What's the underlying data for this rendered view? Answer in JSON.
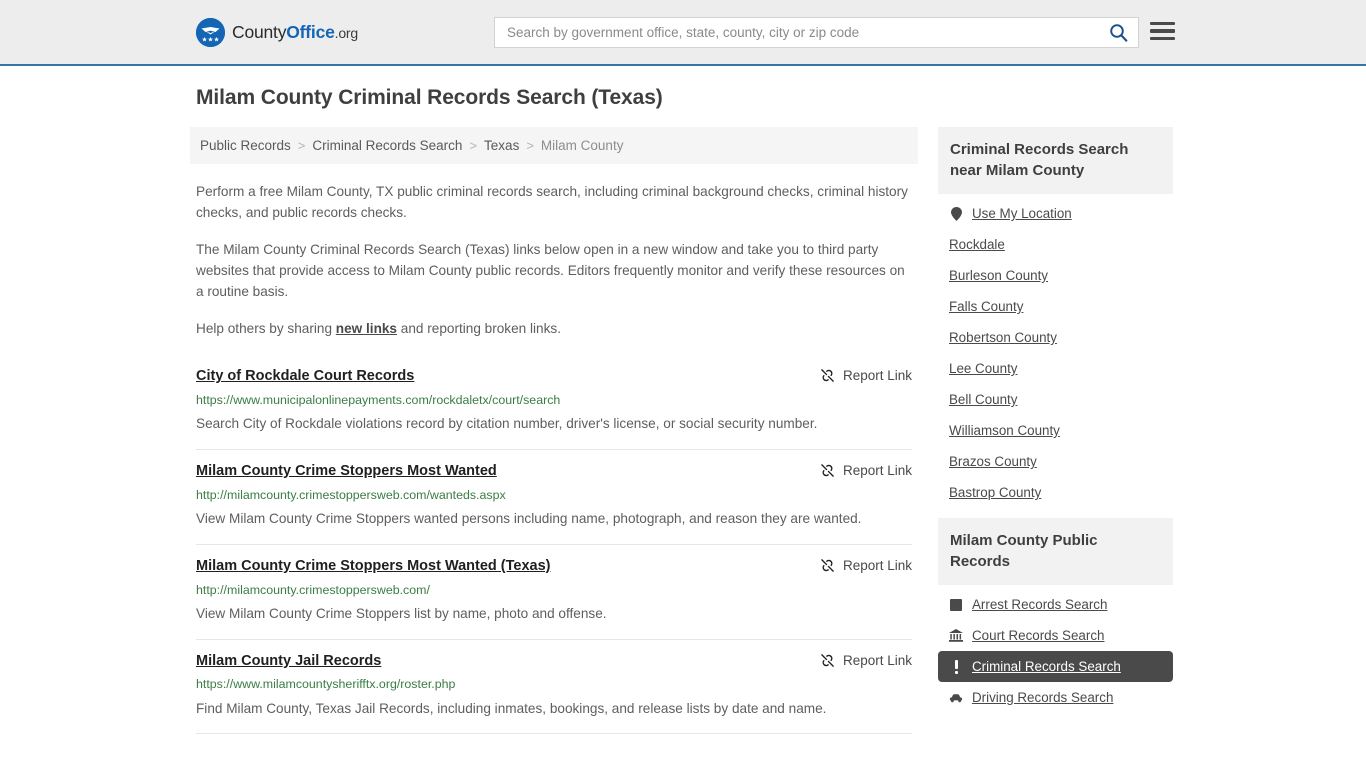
{
  "header": {
    "logo": {
      "icon": "eagle-shield-icon",
      "text_part1": "County",
      "text_part2": "Office",
      "text_part3": ".org",
      "brand_color": "#1565b5"
    },
    "search": {
      "placeholder": "Search by government office, state, county, city or zip code",
      "value": "",
      "search_icon": "magnifier-icon",
      "icon_color": "#1a4f87"
    },
    "menu_icon": "hamburger-menu-icon",
    "background": "#ededed",
    "accent_border": "#3a73a8"
  },
  "main": {
    "page_title": "Milam County Criminal Records Search (Texas)",
    "breadcrumb": {
      "separator": ">",
      "items": [
        {
          "label": "Public Records",
          "current": false
        },
        {
          "label": "Criminal Records Search",
          "current": false
        },
        {
          "label": "Texas",
          "current": false
        },
        {
          "label": "Milam County",
          "current": true
        }
      ]
    },
    "intro": {
      "paragraph1": "Perform a free Milam County, TX public criminal records search, including criminal background checks, criminal history checks, and public records checks.",
      "paragraph2": "The Milam County Criminal Records Search (Texas) links below open in a new window and take you to third party websites that provide access to Milam County public records. Editors frequently monitor and verify these resources on a routine basis.",
      "paragraph3_before": "Help others by sharing ",
      "paragraph3_link": "new links",
      "paragraph3_after": " and reporting broken links."
    },
    "report_link_label": "Report Link",
    "report_link_icon": "broken-link-icon",
    "results": [
      {
        "title": "City of Rockdale Court Records",
        "url": "https://www.municipalonlinepayments.com/rockdaletx/court/search",
        "description": "Search City of Rockdale violations record by citation number, driver's license, or social security number."
      },
      {
        "title": "Milam County Crime Stoppers Most Wanted",
        "url": "http://milamcounty.crimestoppersweb.com/wanteds.aspx",
        "description": "View Milam County Crime Stoppers wanted persons including name, photograph, and reason they are wanted."
      },
      {
        "title": "Milam County Crime Stoppers Most Wanted (Texas)",
        "url": "http://milamcounty.crimestoppersweb.com/",
        "description": "View Milam County Crime Stoppers list by name, photo and offense."
      },
      {
        "title": "Milam County Jail Records",
        "url": "https://www.milamcountysherifftx.org/roster.php",
        "description": "Find Milam County, Texas Jail Records, including inmates, bookings, and release lists by date and name."
      }
    ],
    "url_color": "#3a7d44"
  },
  "sidebar": {
    "nearby": {
      "title": "Criminal Records Search near Milam County",
      "items": [
        {
          "label": "Use My Location",
          "icon": "location-pin-icon"
        },
        {
          "label": "Rockdale",
          "icon": ""
        },
        {
          "label": "Burleson County",
          "icon": ""
        },
        {
          "label": "Falls County",
          "icon": ""
        },
        {
          "label": "Robertson County",
          "icon": ""
        },
        {
          "label": "Lee County",
          "icon": ""
        },
        {
          "label": "Bell County",
          "icon": ""
        },
        {
          "label": "Williamson County",
          "icon": ""
        },
        {
          "label": "Brazos County",
          "icon": ""
        },
        {
          "label": "Bastrop County",
          "icon": ""
        }
      ]
    },
    "public_records": {
      "title": "Milam County Public Records",
      "active_item": "Criminal Records Search",
      "active_background": "#4a4a4a",
      "items": [
        {
          "label": "Arrest Records Search",
          "icon": "square-badge-icon",
          "active": false
        },
        {
          "label": "Court Records Search",
          "icon": "courthouse-icon",
          "active": false
        },
        {
          "label": "Criminal Records Search",
          "icon": "exclamation-icon",
          "active": true
        },
        {
          "label": "Driving Records Search",
          "icon": "car-icon",
          "active": false
        }
      ]
    }
  }
}
